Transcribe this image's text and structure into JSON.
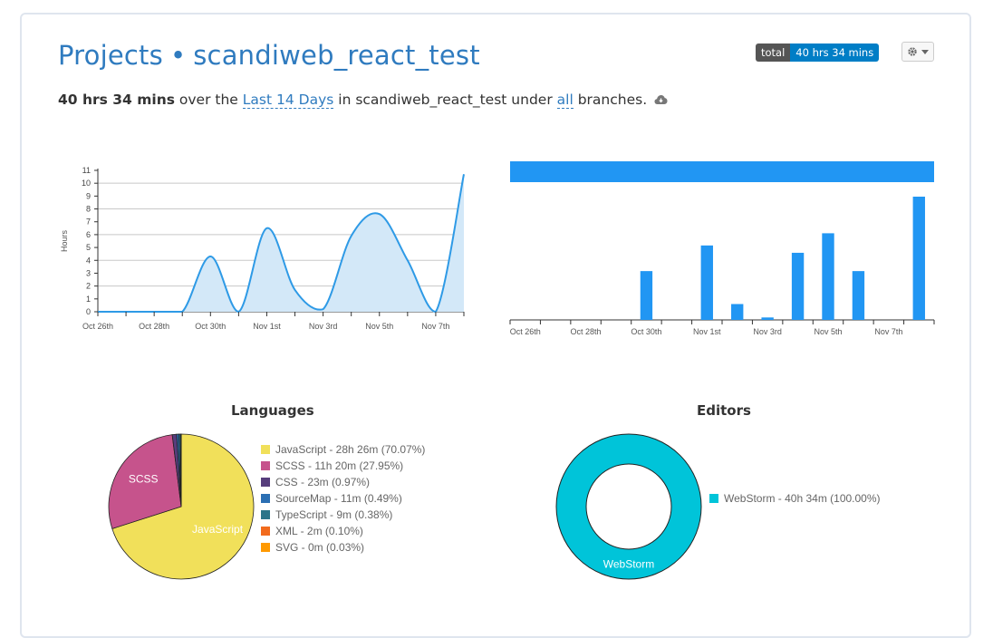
{
  "header": {
    "title_prefix": "Projects",
    "separator": "•",
    "project_name": "scandiweb_react_test",
    "badge_label": "total",
    "badge_value": "40 hrs 34 mins"
  },
  "summary": {
    "duration": "40 hrs 34 mins",
    "text_over": "over the",
    "range_link": "Last 14 Days",
    "text_in": "in scandiweb_react_test under",
    "branch_link": "all",
    "text_end": "branches."
  },
  "icons": {
    "gear": "gear-icon",
    "caret": "caret-down-icon",
    "cloud": "cloud-download-icon"
  },
  "sections": {
    "languages_title": "Languages",
    "editors_title": "Editors"
  },
  "chart_data": [
    {
      "type": "area",
      "ylabel": "Hours",
      "ylim": [
        0,
        11
      ],
      "yticks": [
        0,
        1,
        2,
        3,
        4,
        5,
        6,
        7,
        8,
        9,
        10,
        11
      ],
      "x": [
        "Oct 26th",
        "Oct 27th",
        "Oct 28th",
        "Oct 29th",
        "Oct 30th",
        "Oct 31st",
        "Nov 1st",
        "Nov 2nd",
        "Nov 3rd",
        "Nov 4th",
        "Nov 5th",
        "Nov 6th",
        "Nov 7th",
        "Nov 8th"
      ],
      "xtick_labels": [
        "Oct 26th",
        "Oct 28th",
        "Oct 30th",
        "Nov 1st",
        "Nov 3rd",
        "Nov 5th",
        "Nov 7th"
      ],
      "values": [
        0,
        0,
        0,
        0,
        4.3,
        0,
        6.5,
        1.7,
        0.2,
        5.9,
        7.6,
        4.0,
        0,
        10.7
      ],
      "color": "#2e9ae6",
      "fill": "#d3e8f8",
      "grid": true
    },
    {
      "type": "bar",
      "x": [
        "Oct 26th",
        "Oct 27th",
        "Oct 28th",
        "Oct 29th",
        "Oct 30th",
        "Oct 31st",
        "Nov 1st",
        "Nov 2nd",
        "Nov 3rd",
        "Nov 4th",
        "Nov 5th",
        "Nov 6th",
        "Nov 7th",
        "Nov 8th"
      ],
      "xtick_labels": [
        "Oct 26th",
        "Oct 28th",
        "Oct 30th",
        "Nov 1st",
        "Nov 3rd",
        "Nov 5th",
        "Nov 7th"
      ],
      "values": [
        0,
        0,
        0,
        0,
        4.0,
        0,
        6.1,
        1.3,
        0.2,
        5.5,
        7.1,
        4.0,
        0,
        10.1
      ],
      "max": 10.1,
      "color": "#2196f3",
      "top_band": true
    },
    {
      "type": "pie",
      "title": "Languages",
      "slices": [
        {
          "label": "JavaScript",
          "legend": "JavaScript - 28h 26m (70.07%)",
          "percent": 70.07,
          "color": "#f1e05a",
          "inside_label": "JavaScript"
        },
        {
          "label": "SCSS",
          "legend": "SCSS - 11h 20m (27.95%)",
          "percent": 27.95,
          "color": "#c6538c",
          "inside_label": "SCSS"
        },
        {
          "label": "CSS",
          "legend": "CSS - 23m (0.97%)",
          "percent": 0.97,
          "color": "#563d7c",
          "inside_label": ""
        },
        {
          "label": "SourceMap",
          "legend": "SourceMap - 11m (0.49%)",
          "percent": 0.49,
          "color": "#2b6fb3",
          "inside_label": ""
        },
        {
          "label": "TypeScript",
          "legend": "TypeScript - 9m (0.38%)",
          "percent": 0.38,
          "color": "#2b7489",
          "inside_label": ""
        },
        {
          "label": "XML",
          "legend": "XML - 2m (0.10%)",
          "percent": 0.1,
          "color": "#f26b1d",
          "inside_label": ""
        },
        {
          "label": "SVG",
          "legend": "SVG - 0m (0.03%)",
          "percent": 0.03,
          "color": "#ff9900",
          "inside_label": ""
        }
      ]
    },
    {
      "type": "pie",
      "title": "Editors",
      "donut": true,
      "slices": [
        {
          "label": "WebStorm",
          "legend": "WebStorm - 40h 34m (100.00%)",
          "percent": 100.0,
          "color": "#00c4d9",
          "inside_label": "WebStorm"
        }
      ]
    }
  ]
}
